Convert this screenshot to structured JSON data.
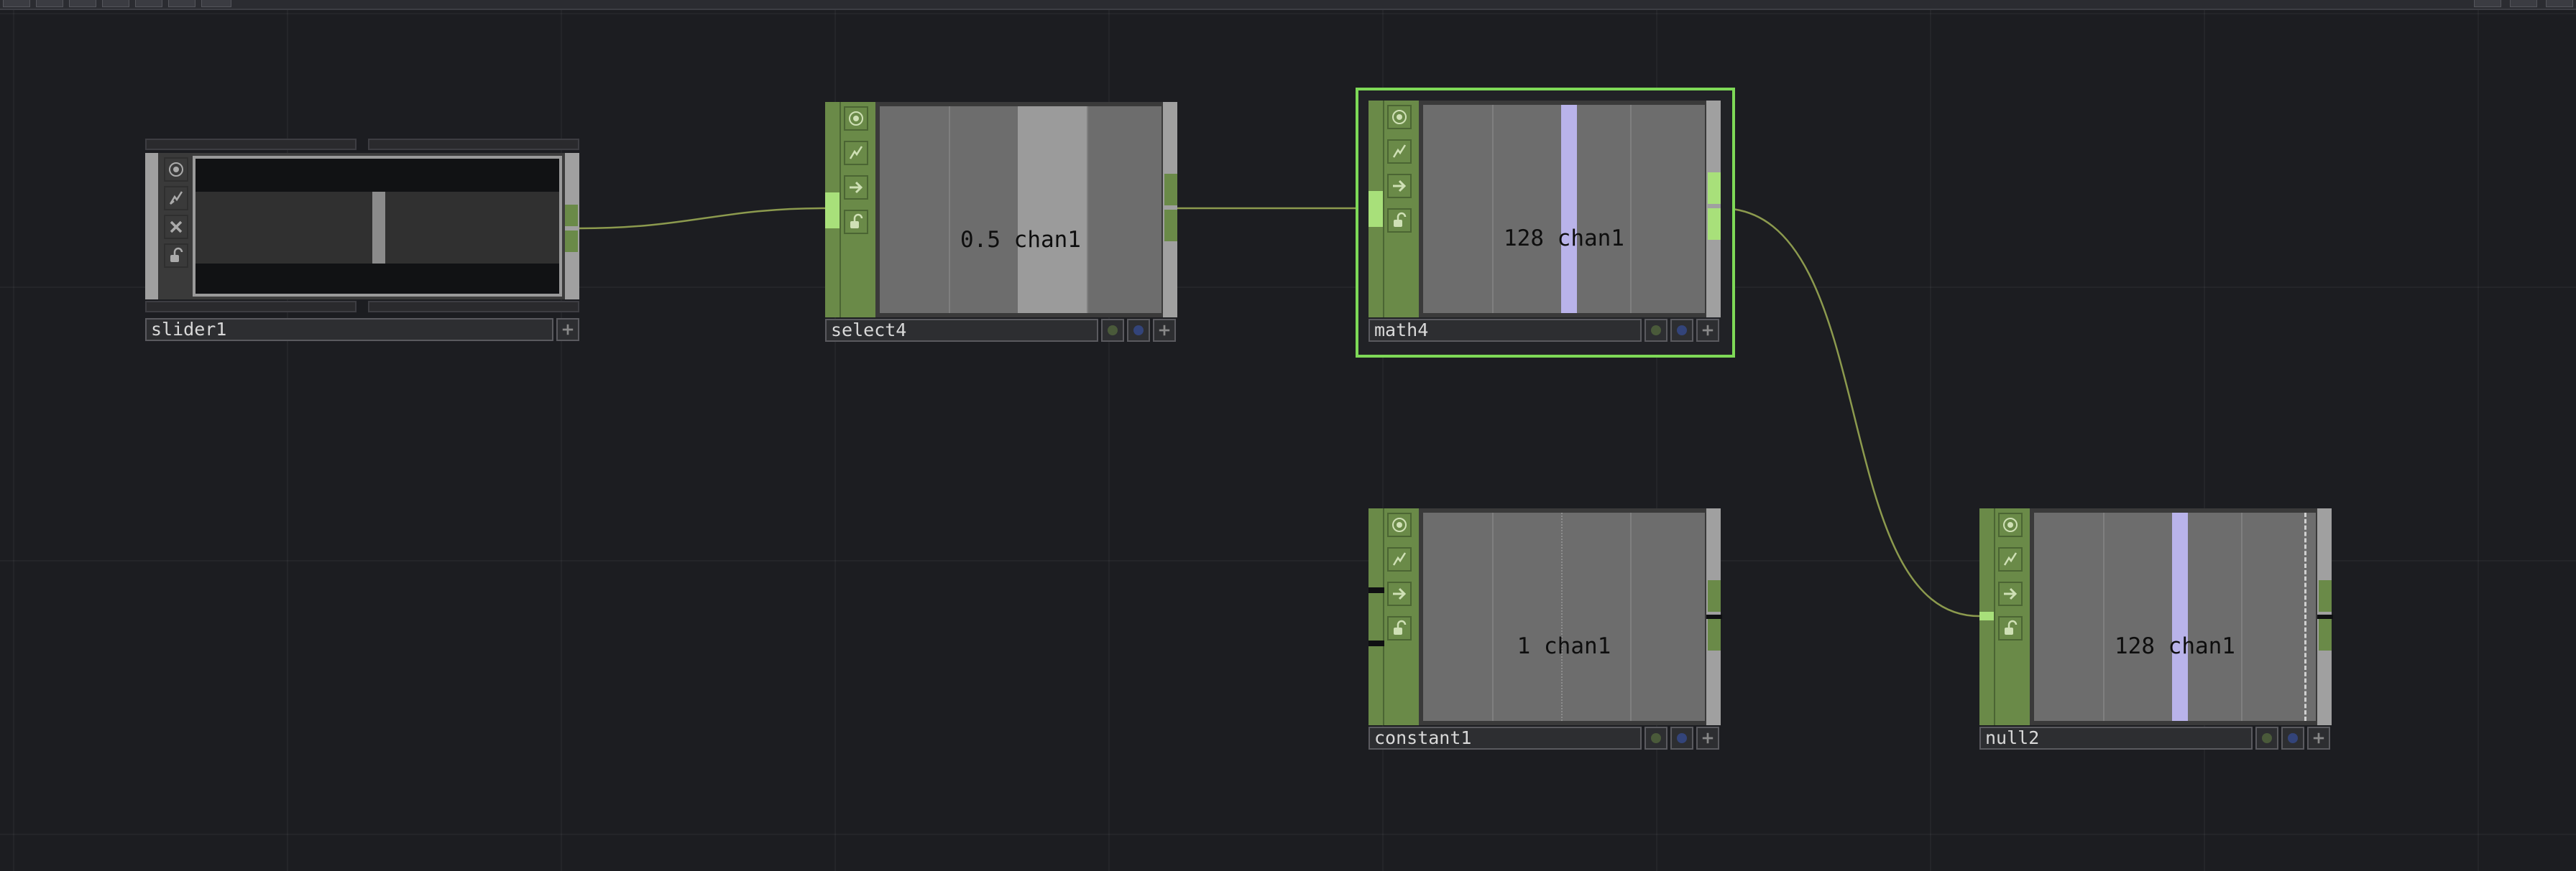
{
  "colors": {
    "background": "#1c1d21",
    "op_green": "#6a8a48",
    "selected_outline": "#7ed957",
    "wire": "#8c9a4e",
    "channel_bar_purple": "#b9b3ea",
    "viewer_gray": "#6d6d6d"
  },
  "network": {
    "nodes": [
      {
        "id": "slider1",
        "name": "slider1",
        "type": "Slider COMP",
        "active": false,
        "selected": false
      },
      {
        "id": "select4",
        "name": "select4",
        "type": "Select CHOP",
        "value_label": "0.5 chan1",
        "active": false,
        "selected": false
      },
      {
        "id": "math4",
        "name": "math4",
        "type": "Math CHOP",
        "value_label": "128 chan1",
        "active": false,
        "selected": true
      },
      {
        "id": "constant1",
        "name": "constant1",
        "type": "Constant CHOP",
        "value_label": "1 chan1",
        "active": false,
        "selected": false
      },
      {
        "id": "null2",
        "name": "null2",
        "type": "Null CHOP",
        "value_label": "128 chan1",
        "active": false,
        "selected": false
      }
    ],
    "wires": [
      {
        "from": "slider1",
        "to": "select4"
      },
      {
        "from": "select4",
        "to": "math4"
      },
      {
        "from": "math4",
        "to": "null2"
      }
    ]
  },
  "slider_value": 0.5,
  "icons": {
    "viewer_toggle": "viewer-active-icon",
    "cook": "cook-flag-icon",
    "export": "export-arrow-icon",
    "lock": "lock-icon",
    "bypass": "bypass-x-icon",
    "display": "display-flag-icon",
    "render": "render-flag-icon",
    "add": "plus-icon"
  }
}
